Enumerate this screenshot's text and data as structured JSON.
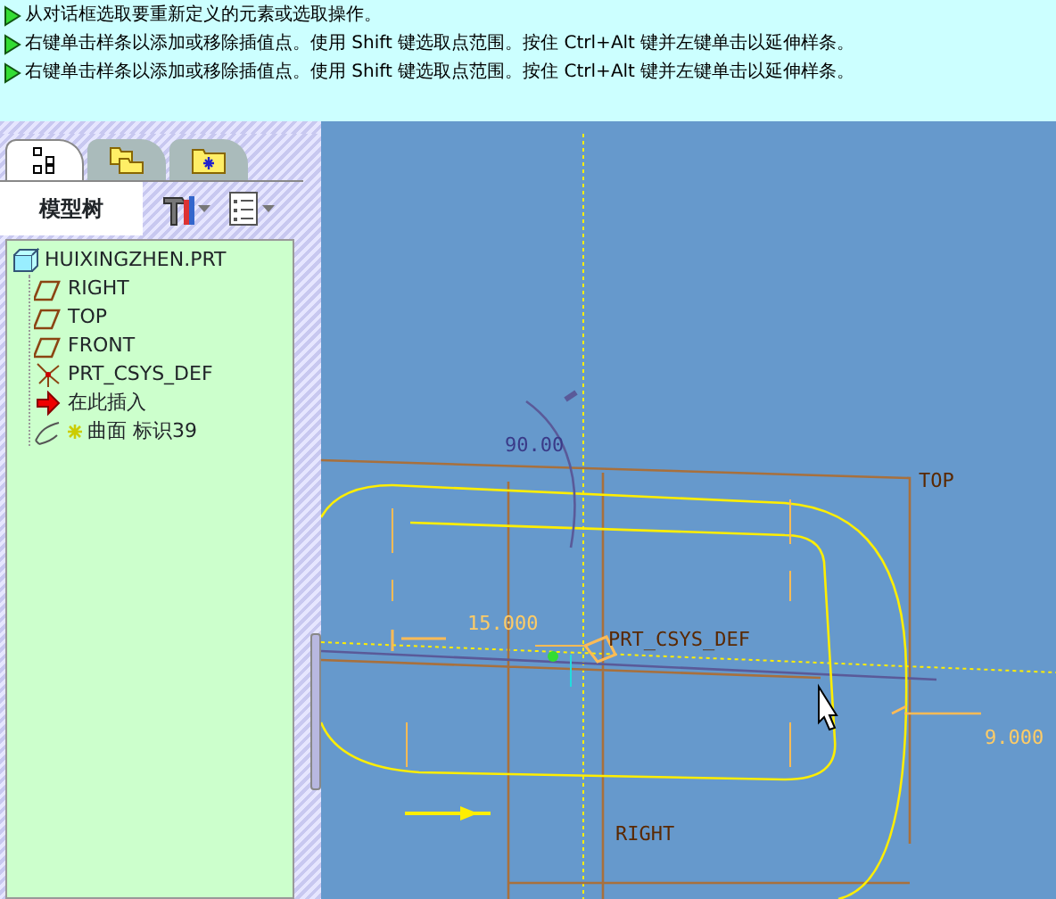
{
  "messages": [
    "从对话框选取要重新定义的元素或选取操作。",
    "右键单击样条以添加或移除插值点。使用 Shift 键选取点范围。按住 Ctrl+Alt 键并左键单击以延伸样条。",
    "右键单击样条以添加或移除插值点。使用 Shift 键选取点范围。按住 Ctrl+Alt 键并左键单击以延伸样条。"
  ],
  "panel_tabs": [
    {
      "kind": "tree",
      "selected": true
    },
    {
      "kind": "folders",
      "selected": false
    },
    {
      "kind": "favorites",
      "selected": false
    }
  ],
  "model_tree": {
    "title": "模型树",
    "root": {
      "kind": "part",
      "label": "HUIXINGZHEN.PRT",
      "children": [
        {
          "kind": "plane",
          "label": "RIGHT"
        },
        {
          "kind": "plane",
          "label": "TOP"
        },
        {
          "kind": "plane",
          "label": "FRONT"
        },
        {
          "kind": "csys",
          "label": "PRT_CSYS_DEF"
        },
        {
          "kind": "insert",
          "label": "在此插入"
        },
        {
          "kind": "surface",
          "label": "曲面 标识39"
        }
      ]
    }
  },
  "canvas": {
    "labels": [
      {
        "kind": "dimension",
        "text": "90.00"
      },
      {
        "kind": "datum",
        "text": "TOP"
      },
      {
        "kind": "dimension",
        "text": "15.000"
      },
      {
        "kind": "datum",
        "text": "PRT_CSYS_DEF"
      },
      {
        "kind": "dimension",
        "text": "9.000"
      },
      {
        "kind": "datum",
        "text": "RIGHT"
      }
    ]
  }
}
